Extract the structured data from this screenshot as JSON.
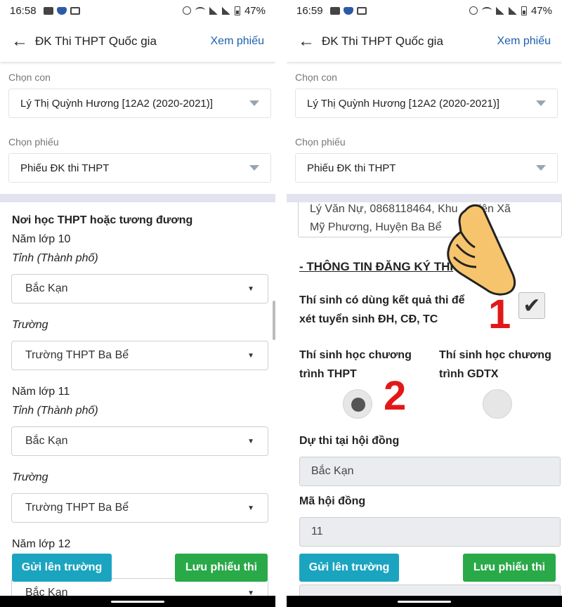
{
  "left": {
    "status": {
      "time": "16:58",
      "battery": "47%"
    },
    "appbar": {
      "title": "ĐK Thi THPT Quốc gia",
      "action": "Xem phiếu"
    },
    "child_label": "Chọn con",
    "child_value": "Lý Thị Quỳnh Hương [12A2 (2020-2021)]",
    "form_label": "Chọn phiếu",
    "form_value": "Phiếu ĐK thi THPT",
    "section_title": "Nơi học THPT hoặc tương đương",
    "grade10": "Năm lớp 10",
    "province_label": "Tỉnh (Thành phố)",
    "province10": "Bắc Kạn",
    "school_label": "Trường",
    "school10": "Trường THPT Ba Bể",
    "grade11": "Năm lớp 11",
    "province11": "Bắc Kạn",
    "school11": "Trường THPT Ba Bể",
    "grade12": "Năm lớp 12",
    "province12": "Bắc Kạn",
    "send_button": "Gửi lên trường",
    "save_button": "Lưu phiếu thi"
  },
  "right": {
    "status": {
      "time": "16:59",
      "battery": "47%"
    },
    "appbar": {
      "title": "ĐK Thi THPT Quốc gia",
      "action": "Xem phiếu"
    },
    "child_label": "Chọn con",
    "child_value": "Lý Thị Quỳnh Hương [12A2 (2020-2021)]",
    "form_label": "Chọn phiếu",
    "form_value": "Phiếu ĐK thi THPT",
    "address_line1": "Lý Văn Nự, 0868118464, Khu",
    "address_line1_end": "iện Xã",
    "address_line2": "Mỹ Phương, Huyện Ba Bể",
    "reg_title": "- THÔNG TIN ĐĂNG KÝ THI",
    "use_result_line1": "Thí sinh có dùng kết quả thi để",
    "use_result_line2": "xét tuyển sinh ĐH, CĐ, TC",
    "marker1": "1",
    "marker2": "2",
    "program_thpt_line1": "Thí sinh học chương",
    "program_thpt_line2": "trình THPT",
    "program_gdtx_line1": "Thí sinh học chương",
    "program_gdtx_line2": "trình GDTX",
    "council_label": "Dự thi tại hội đồng",
    "council_value": "Bắc Kạn",
    "council_code_label": "Mã hội đồng",
    "council_code_value": "11",
    "send_button": "Gửi lên trường",
    "save_button": "Lưu phiếu thi"
  }
}
